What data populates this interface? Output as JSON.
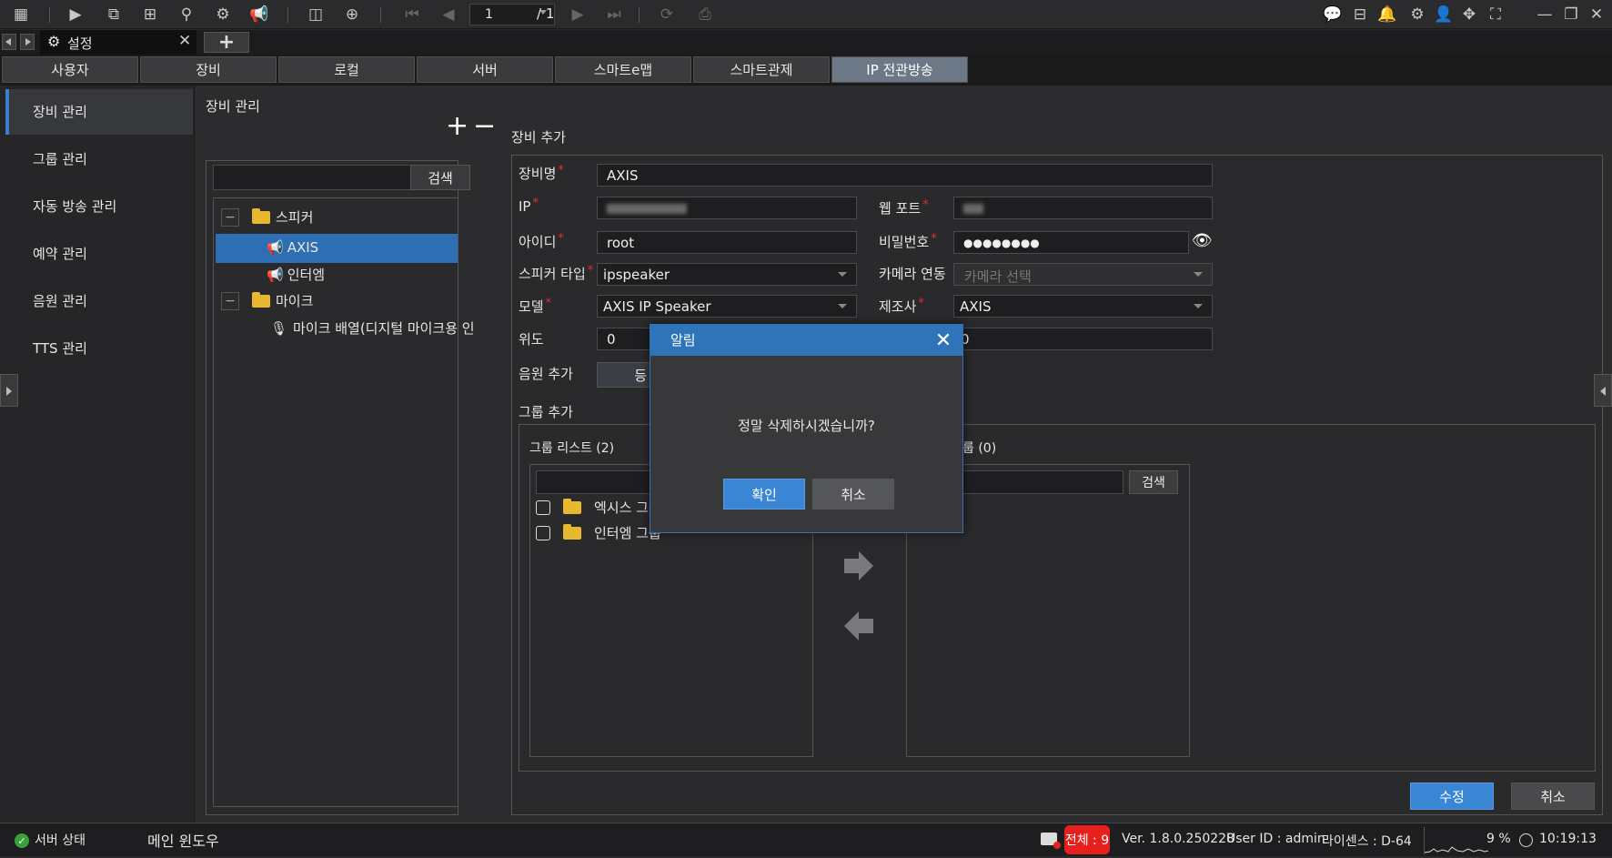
{
  "toolbar": {
    "page_current": "1",
    "page_total": "/ 1"
  },
  "doc_tab": {
    "label": "설정"
  },
  "nav_tabs": [
    "사용자",
    "장비",
    "로컬",
    "서버",
    "스마트e맵",
    "스마트관제",
    "IP 전관방송"
  ],
  "sidebar": {
    "items": [
      "장비 관리",
      "그룹 관리",
      "자동 방송 관리",
      "예약 관리",
      "음원 관리",
      "TTS 관리"
    ]
  },
  "main": {
    "title": "장비 관리",
    "search_btn": "검색",
    "tree": {
      "speaker": "스피커",
      "axis": "AXIS",
      "intercom": "인터엠",
      "mic": "마이크",
      "mic_item": "마이크 배열(디지털 마이크용 인"
    },
    "add_title": "장비 추가",
    "labels": {
      "name": "장비명",
      "ip": "IP",
      "web_port": "웹 포트",
      "id": "아이디",
      "password": "비밀번호",
      "speaker_type": "스피커 타입",
      "camera_link": "카메라 연동",
      "model": "모델",
      "maker": "제조사",
      "lat": "위도",
      "audio_add": "음원 추가",
      "group_add": "그룹 추가"
    },
    "values": {
      "name": "AXIS",
      "id": "root",
      "password": "●●●●●●●●",
      "speaker_type": "ipspeaker",
      "camera_link": "카메라 선택",
      "model": "AXIS IP Speaker",
      "maker": "AXIS",
      "lat": "0",
      "lon": "0"
    },
    "group_list_title": "그룹 리스트 (2)",
    "groups": [
      "엑시스 그룹",
      "인터엠 그룹"
    ],
    "right_group_title": "룹 (0)",
    "right_search": "검색",
    "audio_btn_partial": "등",
    "modify_btn": "수정",
    "cancel_btn": "취소"
  },
  "dialog": {
    "title": "알림",
    "message": "정말 삭제하시겠습니까?",
    "ok": "확인",
    "cancel": "취소"
  },
  "status": {
    "server_state": "서버 상태",
    "main_window": "메인 윈도우",
    "total": "전체 : 9",
    "version": "Ver. 1.8.0.250228",
    "user": "User ID : admin",
    "license": "라이센스 : D-64",
    "cpu": "9 %",
    "time": "10:19:13"
  },
  "colors": {
    "accent": "#3a86d4",
    "dialog_header": "#2f74b8",
    "selected_row": "#2e6fb4",
    "alert": "#e8201c",
    "required": "#e03030"
  }
}
